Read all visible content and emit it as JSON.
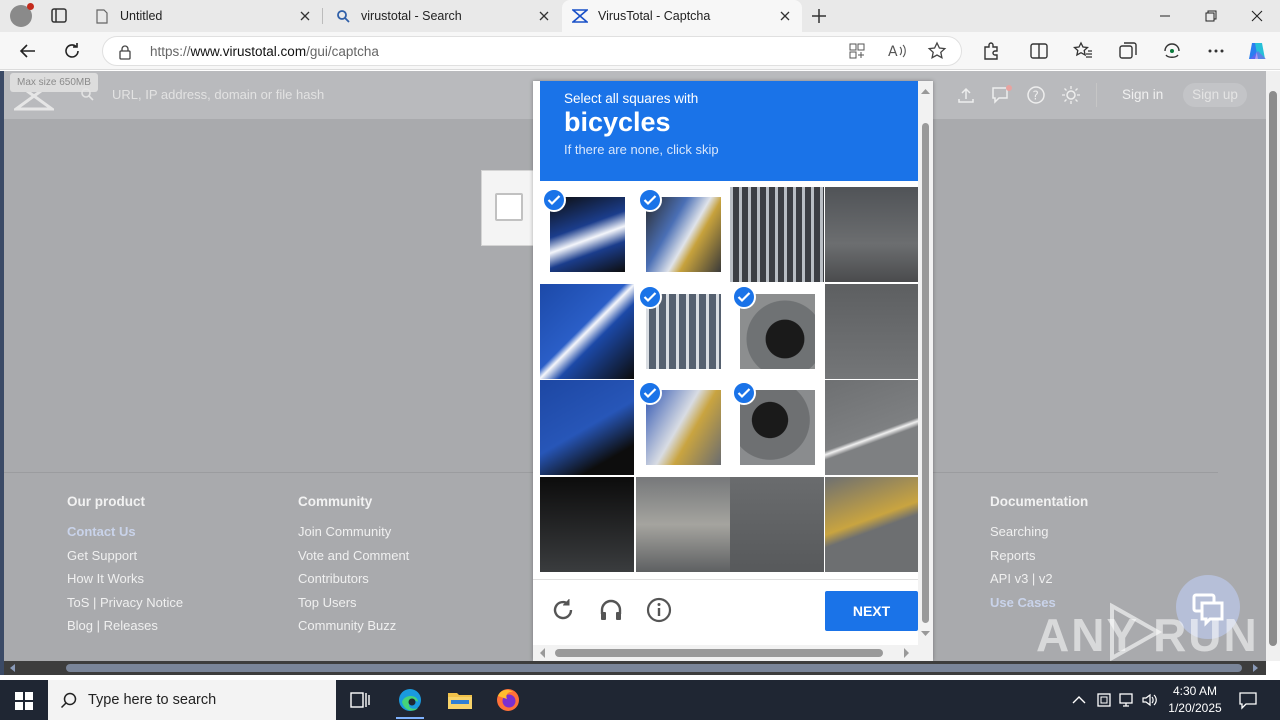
{
  "browser": {
    "tabs": [
      {
        "title": "Untitled",
        "icon": "page-icon"
      },
      {
        "title": "virustotal - Search",
        "icon": "search-icon"
      },
      {
        "title": "VirusTotal - Captcha",
        "icon": "virustotal-icon"
      }
    ],
    "url_prefix": "https://",
    "url_domain": "www.virustotal.com",
    "url_path": "/gui/captcha"
  },
  "virustotal": {
    "max_size": "Max size 650MB",
    "search_placeholder": "URL, IP address, domain or file hash",
    "sign_in": "Sign in",
    "sign_up": "Sign up",
    "footer": {
      "our_product": {
        "title": "Our product",
        "links": [
          "Contact Us",
          "Get Support",
          "How It Works",
          "ToS | Privacy Notice",
          "Blog | Releases"
        ]
      },
      "community": {
        "title": "Community",
        "links": [
          "Join Community",
          "Vote and Comment",
          "Contributors",
          "Top Users",
          "Community Buzz"
        ]
      },
      "documentation": {
        "title": "Documentation",
        "links": [
          "Searching",
          "Reports",
          "API v3 | v2",
          "Use Cases"
        ]
      }
    }
  },
  "captcha": {
    "instruction": "Select all squares with",
    "target": "bicycles",
    "hint": "If there are none, click skip",
    "next_label": "NEXT",
    "tiles_selected": [
      true,
      true,
      false,
      false,
      false,
      true,
      true,
      false,
      false,
      true,
      true,
      false,
      false,
      false,
      false,
      false
    ]
  },
  "watermark": "ANY RUN",
  "taskbar": {
    "search_placeholder": "Type here to search",
    "time": "4:30 AM",
    "date": "1/20/2025"
  },
  "colors": {
    "captcha_blue": "#1a73e8",
    "taskbar": "#1f2633"
  }
}
